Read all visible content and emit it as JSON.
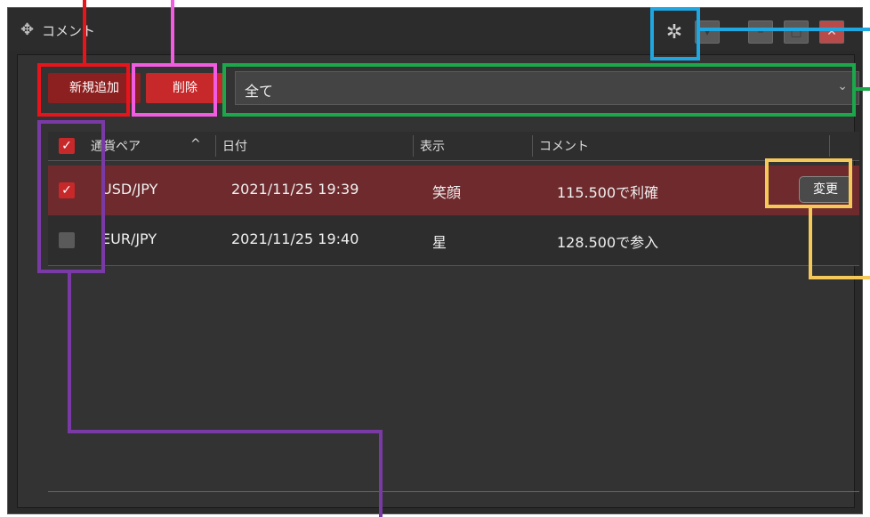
{
  "window": {
    "title": "コメント",
    "move_icon": "move-icon",
    "settings_icon": "gear-icon"
  },
  "toolbar": {
    "add_label": "新規追加",
    "delete_label": "削除",
    "filter_value": "全て"
  },
  "table": {
    "headers": [
      "通貨ペア",
      "日付",
      "表示",
      "コメント"
    ],
    "sort_indicator": "^",
    "rows": [
      {
        "checked": true,
        "pair": "USD/JPY",
        "date": "2021/11/25 19:39",
        "display": "笑顔",
        "comment": "115.500で利確",
        "action": "変更"
      },
      {
        "checked": false,
        "pair": "EUR/JPY",
        "date": "2021/11/25 19:40",
        "display": "星",
        "comment": "128.500で参入"
      }
    ]
  },
  "colors": {
    "accent_red": "#c7282a",
    "selected_row": "#6e2a2d",
    "annotation_red": "#e8141c",
    "annotation_pink": "#f25ce0",
    "annotation_green": "#1aa84a",
    "annotation_blue": "#1ea7e1",
    "annotation_yellow": "#f5c85a",
    "annotation_purple": "#7a3aa6"
  }
}
